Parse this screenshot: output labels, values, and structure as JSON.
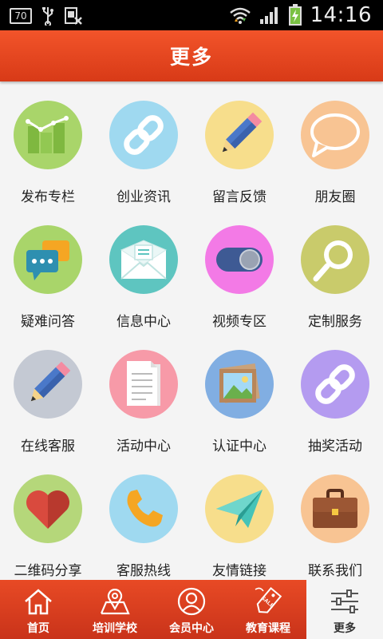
{
  "status_bar": {
    "battery_level": "70",
    "time": "14:16"
  },
  "header": {
    "title": "更多"
  },
  "grid": {
    "items": [
      {
        "label": "发布专栏",
        "icon": "bar-chart-icon",
        "color": "#a9d56a"
      },
      {
        "label": "创业资讯",
        "icon": "link-icon",
        "color": "#9fd9f0"
      },
      {
        "label": "留言反馈",
        "icon": "pencil-icon",
        "color": "#f7de8c"
      },
      {
        "label": "朋友圈",
        "icon": "speech-bubble-icon",
        "color": "#f8c493"
      },
      {
        "label": "疑难问答",
        "icon": "chat-bubbles-icon",
        "color": "#a9d56a"
      },
      {
        "label": "信息中心",
        "icon": "envelope-icon",
        "color": "#5ec5c0"
      },
      {
        "label": "视频专区",
        "icon": "toggle-icon",
        "color": "#f37ae6"
      },
      {
        "label": "定制服务",
        "icon": "magnifier-icon",
        "color": "#c9cb6b"
      },
      {
        "label": "在线客服",
        "icon": "pencil-icon",
        "color": "#c4c9d3"
      },
      {
        "label": "活动中心",
        "icon": "document-icon",
        "color": "#f79aa8"
      },
      {
        "label": "认证中心",
        "icon": "picture-icon",
        "color": "#81aee2"
      },
      {
        "label": "抽奖活动",
        "icon": "link-icon",
        "color": "#b49bf0"
      },
      {
        "label": "二维码分享",
        "icon": "heart-icon",
        "color": "#b5d77a"
      },
      {
        "label": "客服热线",
        "icon": "phone-icon",
        "color": "#9fd9f0"
      },
      {
        "label": "友情链接",
        "icon": "paper-plane-icon",
        "color": "#f7de8c"
      },
      {
        "label": "联系我们",
        "icon": "briefcase-icon",
        "color": "#f8c493"
      }
    ]
  },
  "bottom_nav": {
    "items": [
      {
        "label": "首页",
        "icon": "home-icon",
        "active": false
      },
      {
        "label": "培训学校",
        "icon": "map-pin-icon",
        "active": false
      },
      {
        "label": "会员中心",
        "icon": "user-icon",
        "active": false
      },
      {
        "label": "教育课程",
        "icon": "sale-tag-icon",
        "active": false
      },
      {
        "label": "更多",
        "icon": "sliders-icon",
        "active": true
      }
    ]
  }
}
